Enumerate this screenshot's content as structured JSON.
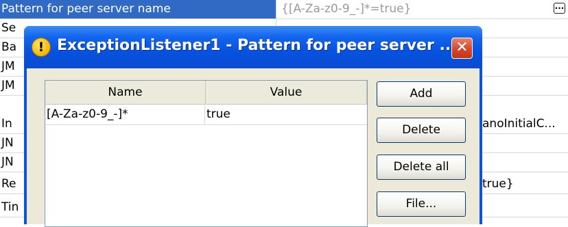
{
  "grid": {
    "rows": [
      {
        "name": "Pattern for peer server name",
        "value": "{[A-Za-z0-9_-]*=true}"
      },
      {
        "name": "Se",
        "value": ""
      },
      {
        "name": "Ba",
        "value": ""
      },
      {
        "name": "JM",
        "value": ""
      },
      {
        "name": "JM",
        "value": ""
      },
      {
        "name": "In",
        "value": "anoInitialC..."
      },
      {
        "name": "JN",
        "value": ""
      },
      {
        "name": "JN",
        "value": ""
      },
      {
        "name": "Re",
        "value": "true}"
      },
      {
        "name": "Tin",
        "value": ""
      }
    ],
    "edit_button_glyph": "..."
  },
  "dialog": {
    "title": "ExceptionListener1 - Pattern for peer server ...",
    "icon": "warning-icon",
    "close_glyph": "✕",
    "table": {
      "columns": [
        "Name",
        "Value"
      ],
      "rows": [
        {
          "name": "[A-Za-z0-9_-]*",
          "value": "true"
        }
      ]
    },
    "buttons": {
      "add": "Add",
      "delete": "Delete",
      "delete_all": "Delete all",
      "file": "File..."
    }
  },
  "colors": {
    "selection": "#316ac5",
    "titlebar": "#0552e0",
    "close": "#d3472a",
    "dialog_bg": "#ece9d8"
  }
}
